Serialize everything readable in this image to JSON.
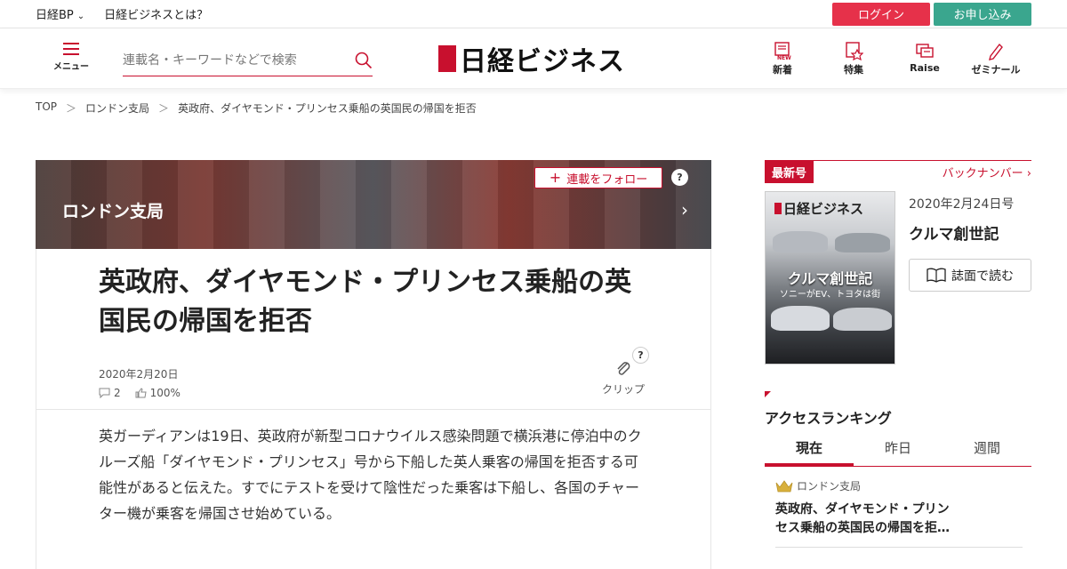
{
  "topbar": {
    "brand": "日経BP",
    "about": "日経ビジネスとは？",
    "login": "ログイン",
    "apply": "お申し込み"
  },
  "header": {
    "menu_label": "メニュー",
    "search_placeholder": "連載名・キーワードなどで検索",
    "logo_text": "日経ビジネス",
    "nav": [
      {
        "label": "新着",
        "icon": "new-icon"
      },
      {
        "label": "特集",
        "icon": "feature-icon"
      },
      {
        "label": "Raise",
        "icon": "raise-icon"
      },
      {
        "label": "ゼミナール",
        "icon": "pen-icon"
      }
    ]
  },
  "breadcrumb": {
    "items": [
      "TOP",
      "ロンドン支局",
      "英政府、ダイヤモンド・プリンセス乗船の英国民の帰国を拒否"
    ],
    "separator": "＞"
  },
  "series": {
    "name": "ロンドン支局",
    "follow_label": "連載をフォロー",
    "help": "?"
  },
  "article": {
    "title": "英政府、ダイヤモンド・プリンセス乗船の英国民の帰国を拒否",
    "date": "2020年2月20日",
    "comments": "2",
    "likes": "100%",
    "clip_label": "クリップ",
    "help": "?",
    "lead": "英ガーディアンは19日、英政府が新型コロナウイルス感染問題で横浜港に停泊中のクルーズ船「ダイヤモンド・プリンセス」号から下船した英人乗客の帰国を拒否する可能性があると伝えた。すでにテストを受けて陰性だった乗客は下船し、各国のチャーター機が乗客を帰国させ始めている。"
  },
  "sidebar": {
    "latest_label": "最新号",
    "back_numbers": "バックナンバー",
    "issue_date": "2020年2月24日号",
    "issue_title": "クルマ創世記",
    "read_label": "誌面で読む",
    "cover": {
      "logo": "日経ビジネス",
      "headline": "クルマ創世記",
      "sub": "ソニーがEV、トヨタは街"
    },
    "ranking_title": "アクセスランキング",
    "tabs": [
      "現在",
      "昨日",
      "週間"
    ],
    "rank1": {
      "category": "ロンドン支局",
      "text": "英政府、ダイヤモンド・プリンセス乗船の英国民の帰国を拒…"
    }
  },
  "colors": {
    "accent": "#c8102e",
    "login": "#e6314a",
    "apply": "#3aa68e"
  }
}
